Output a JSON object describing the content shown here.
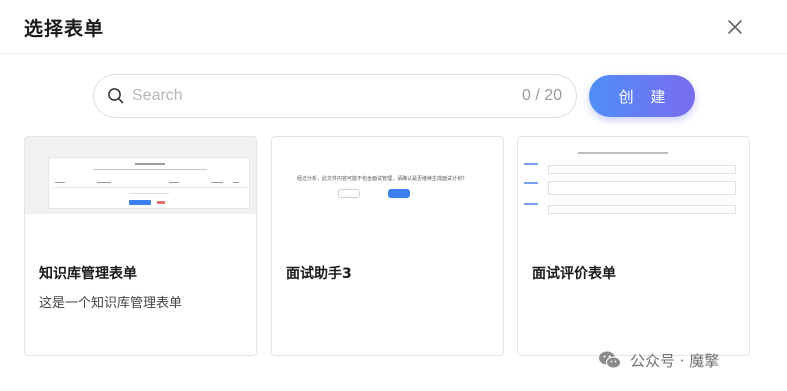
{
  "header": {
    "title": "选择表单",
    "close_icon": "close-icon"
  },
  "search": {
    "placeholder": "Search",
    "value": "",
    "counter": "0 / 20",
    "icon": "search-icon"
  },
  "actions": {
    "create_label": "创 建",
    "create_gradient": [
      "#4f8ef7",
      "#7a6cf0"
    ]
  },
  "cards": [
    {
      "name": "知识库管理表单",
      "description": "这是一个知识库管理表单"
    },
    {
      "name": "面试助手3",
      "description": "",
      "thumb_question": "经过分析，此文件内容可能不包含面试管理，请确认是否继续生成面试计划？"
    },
    {
      "name": "面试评价表单",
      "description": ""
    }
  ],
  "watermark": {
    "text": "公众号 · 魔擎",
    "icon": "wechat-icon"
  }
}
